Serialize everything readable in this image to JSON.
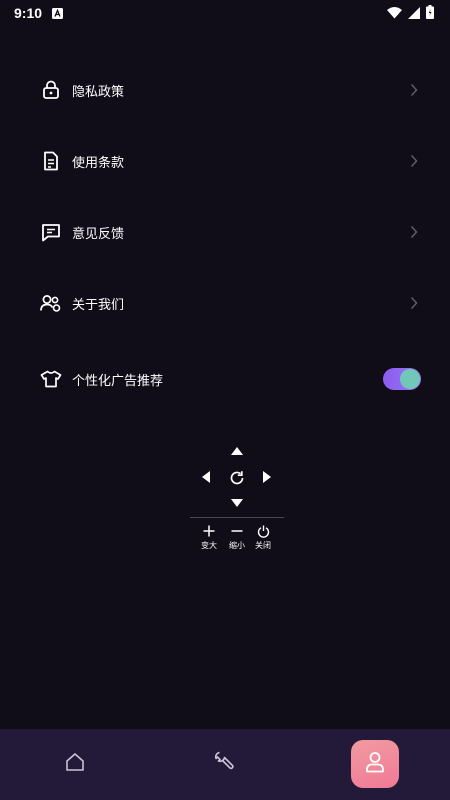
{
  "status_bar": {
    "time": "9:10",
    "notification_icon": "a-badge-icon",
    "wifi_icon": "wifi-icon",
    "signal_icon": "signal-icon",
    "battery_icon": "battery-icon"
  },
  "settings": {
    "items": [
      {
        "label": "隐私政策",
        "icon": "lock-icon",
        "has_chevron": true
      },
      {
        "label": "使用条款",
        "icon": "document-icon",
        "has_chevron": true
      },
      {
        "label": "意见反馈",
        "icon": "message-icon",
        "has_chevron": true
      },
      {
        "label": "关于我们",
        "icon": "users-icon",
        "has_chevron": true
      },
      {
        "label": "个性化广告推荐",
        "icon": "tshirt-icon",
        "toggle_on": true
      }
    ]
  },
  "remote": {
    "zoom_in_label": "变大",
    "zoom_out_label": "缩小",
    "close_label": "关闭"
  },
  "bottom_nav": {
    "items": [
      {
        "icon": "home-icon",
        "active": false
      },
      {
        "icon": "wrench-icon",
        "active": false
      },
      {
        "icon": "profile-icon",
        "active": true
      }
    ]
  },
  "colors": {
    "background": "#100d19",
    "nav_background": "#231a3a",
    "toggle_track": "#8a5cf2",
    "toggle_knob": "#72c8b8",
    "active_tab": "#f07a96"
  }
}
